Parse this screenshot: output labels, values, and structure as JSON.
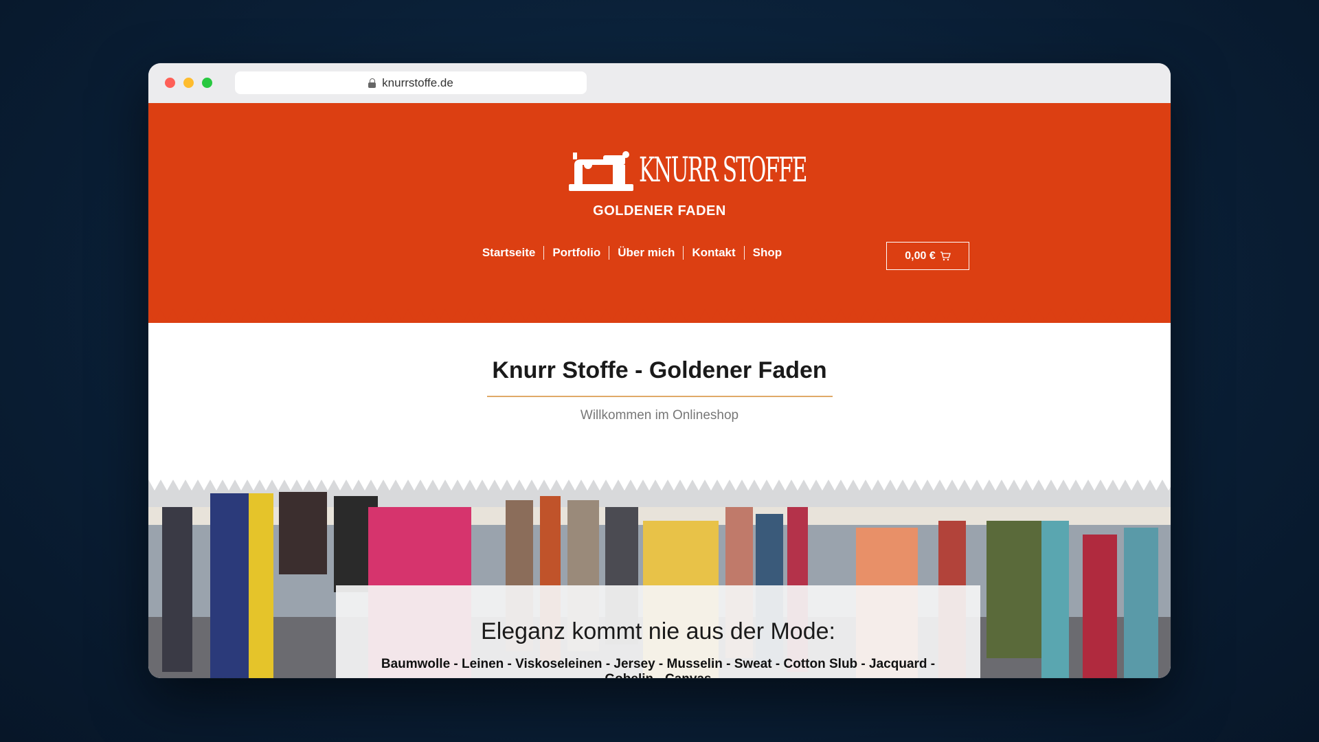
{
  "browser": {
    "url": "knurrstoffe.de"
  },
  "site": {
    "logo_text": "KNURR STOFFE",
    "tagline": "GOLDENER FADEN",
    "nav": [
      {
        "label": "Startseite"
      },
      {
        "label": "Portfolio"
      },
      {
        "label": "Über mich"
      },
      {
        "label": "Kontakt"
      },
      {
        "label": "Shop"
      }
    ],
    "cart_total": "0,00 €",
    "brand_color": "#dc3f12",
    "accent_color": "#e0a968"
  },
  "main": {
    "title": "Knurr Stoffe - Goldener Faden",
    "subtitle": "Willkommen im Onlineshop"
  },
  "hero": {
    "title": "Eleganz kommt nie aus der Mode:",
    "fabrics": "Baumwolle - Leinen - Viskoseleinen - Jersey - Musselin - Sweat - Cotton Slub - Jacquard - Gobelin - Canvas"
  }
}
